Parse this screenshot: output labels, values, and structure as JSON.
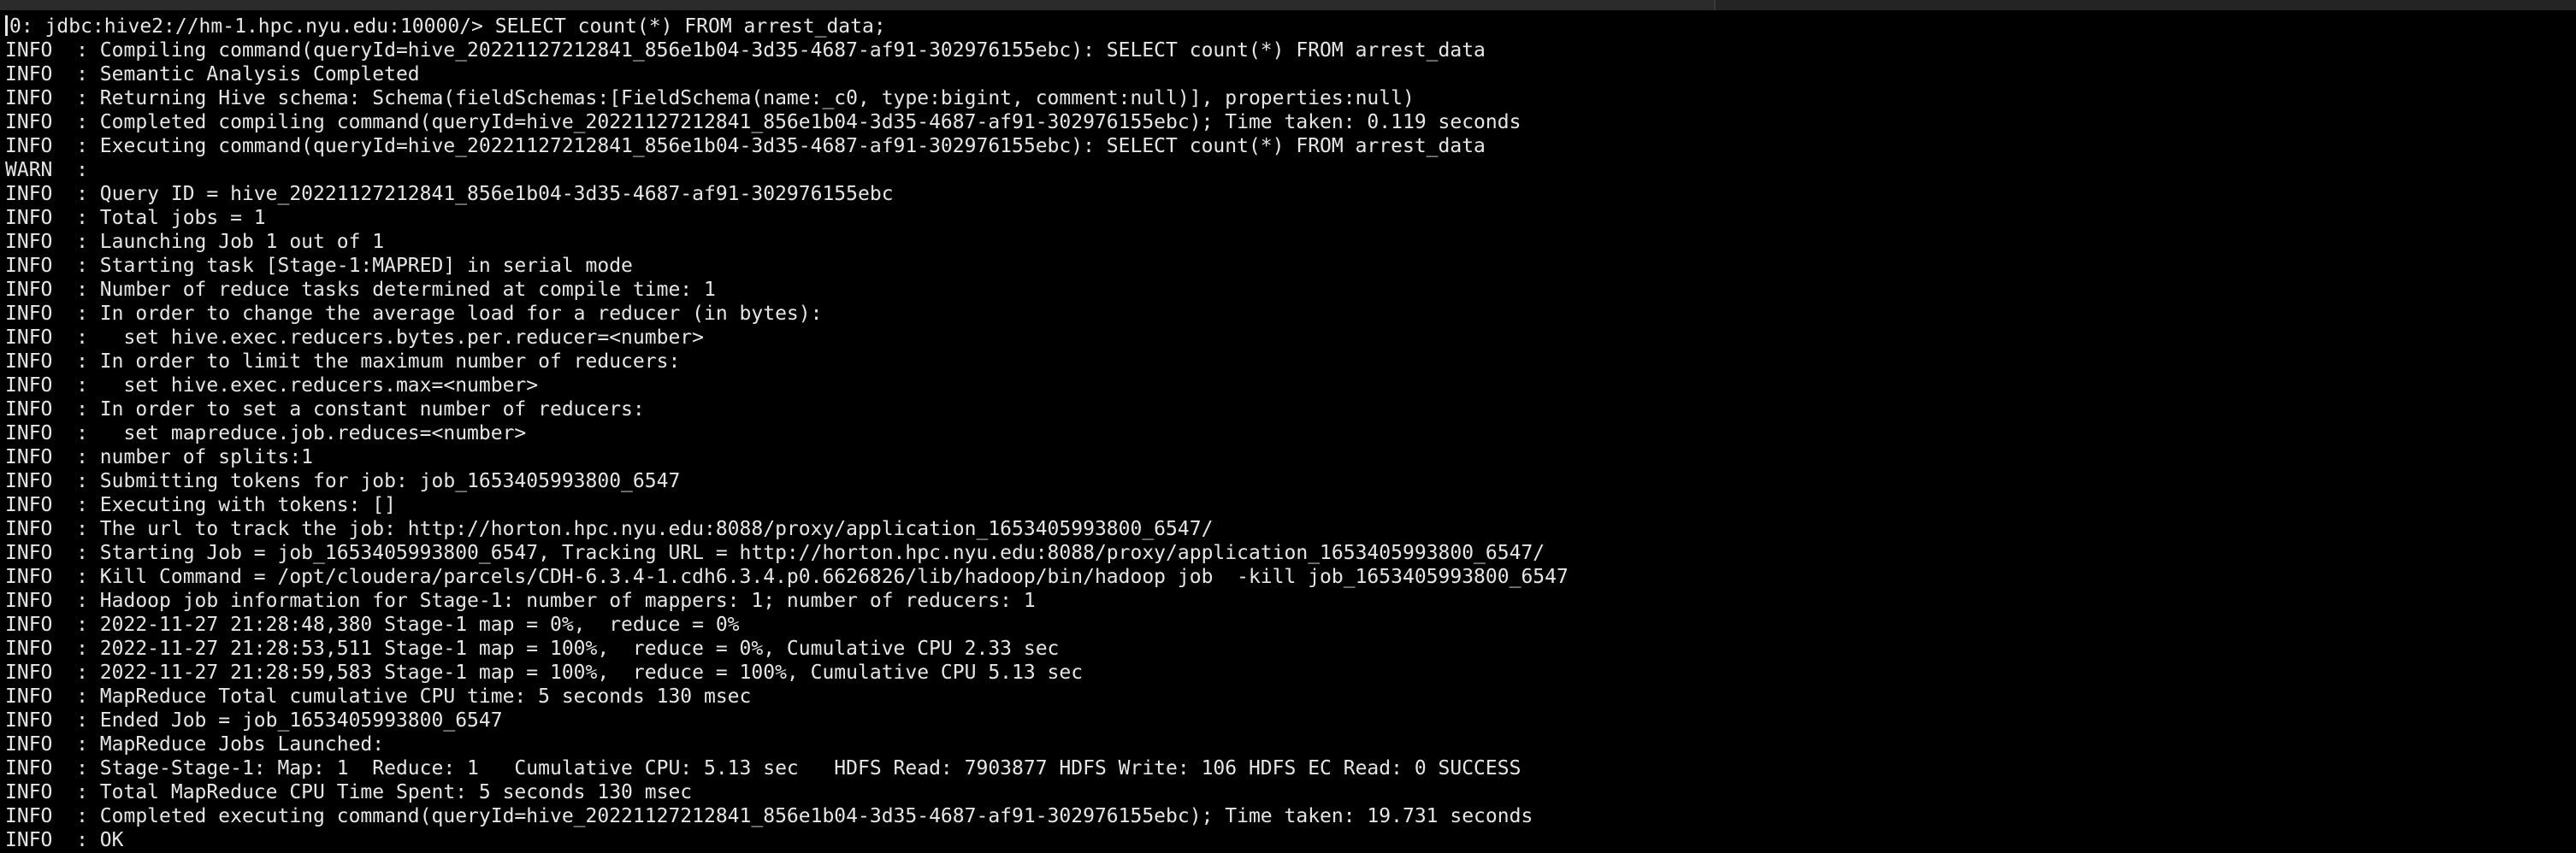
{
  "terminal": {
    "lines": [
      "0: jdbc:hive2://hm-1.hpc.nyu.edu:10000/> SELECT count(*) FROM arrest_data;",
      "INFO  : Compiling command(queryId=hive_20221127212841_856e1b04-3d35-4687-af91-302976155ebc): SELECT count(*) FROM arrest_data",
      "INFO  : Semantic Analysis Completed",
      "INFO  : Returning Hive schema: Schema(fieldSchemas:[FieldSchema(name:_c0, type:bigint, comment:null)], properties:null)",
      "INFO  : Completed compiling command(queryId=hive_20221127212841_856e1b04-3d35-4687-af91-302976155ebc); Time taken: 0.119 seconds",
      "INFO  : Executing command(queryId=hive_20221127212841_856e1b04-3d35-4687-af91-302976155ebc): SELECT count(*) FROM arrest_data",
      "WARN  :",
      "INFO  : Query ID = hive_20221127212841_856e1b04-3d35-4687-af91-302976155ebc",
      "INFO  : Total jobs = 1",
      "INFO  : Launching Job 1 out of 1",
      "INFO  : Starting task [Stage-1:MAPRED] in serial mode",
      "INFO  : Number of reduce tasks determined at compile time: 1",
      "INFO  : In order to change the average load for a reducer (in bytes):",
      "INFO  :   set hive.exec.reducers.bytes.per.reducer=<number>",
      "INFO  : In order to limit the maximum number of reducers:",
      "INFO  :   set hive.exec.reducers.max=<number>",
      "INFO  : In order to set a constant number of reducers:",
      "INFO  :   set mapreduce.job.reduces=<number>",
      "INFO  : number of splits:1",
      "INFO  : Submitting tokens for job: job_1653405993800_6547",
      "INFO  : Executing with tokens: []",
      "INFO  : The url to track the job: http://horton.hpc.nyu.edu:8088/proxy/application_1653405993800_6547/",
      "INFO  : Starting Job = job_1653405993800_6547, Tracking URL = http://horton.hpc.nyu.edu:8088/proxy/application_1653405993800_6547/",
      "INFO  : Kill Command = /opt/cloudera/parcels/CDH-6.3.4-1.cdh6.3.4.p0.6626826/lib/hadoop/bin/hadoop job  -kill job_1653405993800_6547",
      "INFO  : Hadoop job information for Stage-1: number of mappers: 1; number of reducers: 1",
      "INFO  : 2022-11-27 21:28:48,380 Stage-1 map = 0%,  reduce = 0%",
      "INFO  : 2022-11-27 21:28:53,511 Stage-1 map = 100%,  reduce = 0%, Cumulative CPU 2.33 sec",
      "INFO  : 2022-11-27 21:28:59,583 Stage-1 map = 100%,  reduce = 100%, Cumulative CPU 5.13 sec",
      "INFO  : MapReduce Total cumulative CPU time: 5 seconds 130 msec",
      "INFO  : Ended Job = job_1653405993800_6547",
      "INFO  : MapReduce Jobs Launched:",
      "INFO  : Stage-Stage-1: Map: 1  Reduce: 1   Cumulative CPU: 5.13 sec   HDFS Read: 7903877 HDFS Write: 106 HDFS EC Read: 0 SUCCESS",
      "INFO  : Total MapReduce CPU Time Spent: 5 seconds 130 msec",
      "INFO  : Completed executing command(queryId=hive_20221127212841_856e1b04-3d35-4687-af91-302976155ebc); Time taken: 19.731 seconds",
      "INFO  : OK"
    ]
  },
  "colors": {
    "background": "#000000",
    "text": "#e6e6e6"
  }
}
